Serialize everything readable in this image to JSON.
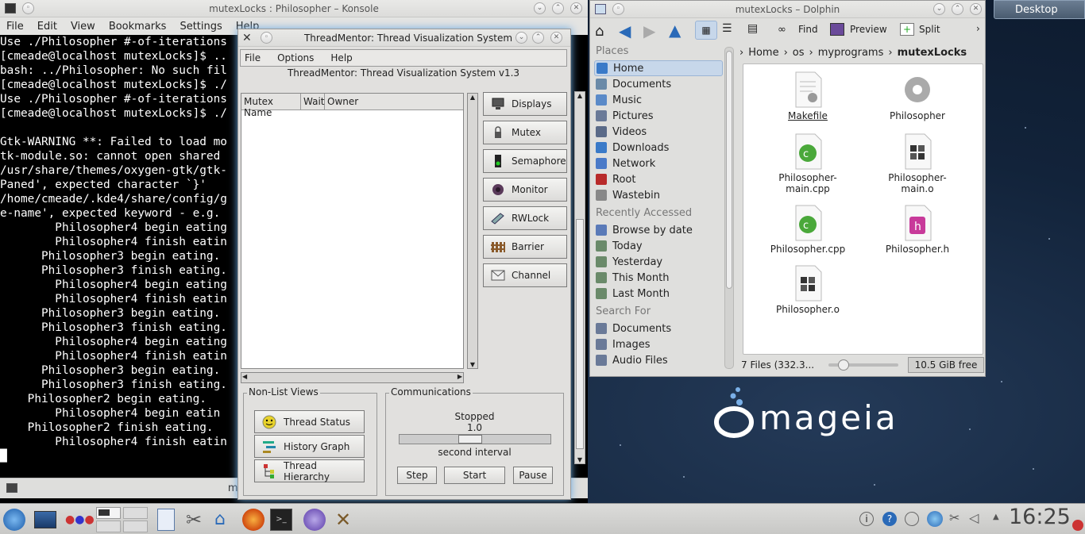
{
  "konsole": {
    "title": "mutexLocks : Philosopher – Konsole",
    "menu": [
      "File",
      "Edit",
      "View",
      "Bookmarks",
      "Settings",
      "Help"
    ],
    "lines": [
      "Use ./Philosopher #-of-iterations",
      "[cmeade@localhost mutexLocks]$ ..",
      "bash: ../Philosopher: No such fil",
      "[cmeade@localhost mutexLocks]$ ./",
      "Use ./Philosopher #-of-iterations",
      "[cmeade@localhost mutexLocks]$ ./",
      "",
      "Gtk-WARNING **: Failed to load mo",
      "tk-module.so: cannot open shared",
      "/usr/share/themes/oxygen-gtk/gtk-",
      "Paned', expected character `}'",
      "/home/cmeade/.kde4/share/config/g",
      "e-name', expected keyword - e.g.",
      "        Philosopher4 begin eating",
      "        Philosopher4 finish eatin",
      "      Philosopher3 begin eating.",
      "      Philosopher3 finish eating.",
      "        Philosopher4 begin eating",
      "        Philosopher4 finish eatin",
      "      Philosopher3 begin eating.",
      "      Philosopher3 finish eating.",
      "        Philosopher4 begin eating",
      "        Philosopher4 finish eatin",
      "      Philosopher3 begin eating.",
      "      Philosopher3 finish eating.",
      "    Philosopher2 begin eating.",
      "        Philosopher4 begin eatin",
      "    Philosopher2 finish eating.",
      "        Philosopher4 finish eatin",
      "█"
    ],
    "tab_label": "mutexLocks : Philosopher"
  },
  "threadmentor": {
    "title": "ThreadMentor: Thread Visualization System",
    "menu": [
      "File",
      "Options",
      "Help"
    ],
    "subtitle": "ThreadMentor: Thread Visualization System v1.3",
    "columns": [
      "Mutex Name",
      "Wait",
      "Owner"
    ],
    "tools": [
      "Displays",
      "Mutex",
      "Semaphore",
      "Monitor",
      "RWLock",
      "Barrier",
      "Channel"
    ],
    "nonlist": {
      "legend": "Non-List Views",
      "buttons": [
        "Thread Status",
        "History Graph",
        "Thread Hierarchy"
      ]
    },
    "comm": {
      "legend": "Communications",
      "status": "Stopped",
      "value": "1.0",
      "unit": "second interval",
      "buttons": [
        "Step",
        "Start",
        "Pause"
      ]
    }
  },
  "dolphin": {
    "title": "mutexLocks – Dolphin",
    "toolbar": {
      "find": "Find",
      "preview": "Preview",
      "split": "Split"
    },
    "places_header": "Places",
    "places": [
      "Home",
      "Documents",
      "Music",
      "Pictures",
      "Videos",
      "Downloads",
      "Network",
      "Root",
      "Wastebin"
    ],
    "recent_header": "Recently Accessed",
    "recent": [
      "Browse by date",
      "Today",
      "Yesterday",
      "This Month",
      "Last Month"
    ],
    "search_header": "Search For",
    "search": [
      "Documents",
      "Images",
      "Audio Files"
    ],
    "breadcrumb": [
      "Home",
      "os",
      "myprograms",
      "mutexLocks"
    ],
    "files": [
      {
        "name": "Makefile",
        "icon": "makefile-icon"
      },
      {
        "name": "Philosopher",
        "icon": "executable-gear-icon"
      },
      {
        "name": "Philosopher-\nmain.cpp",
        "icon": "cpp-file-icon"
      },
      {
        "name": "Philosopher-\nmain.o",
        "icon": "object-file-icon"
      },
      {
        "name": "Philosopher.cpp",
        "icon": "cpp-file-icon"
      },
      {
        "name": "Philosopher.h",
        "icon": "header-file-icon"
      },
      {
        "name": "Philosopher.o",
        "icon": "object-file-icon"
      }
    ],
    "status": "7 Files (332.3...",
    "free": "10.5 GiB free"
  },
  "desktop": {
    "button": "Desktop",
    "logo": "mageia"
  },
  "taskbar": {
    "clock": "16:25"
  }
}
